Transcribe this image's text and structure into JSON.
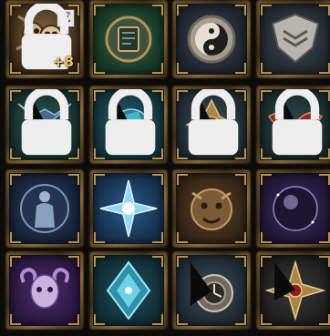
{
  "grid": {
    "slots": [
      {
        "id": "skull-relic",
        "icon": "skull-relic-icon",
        "badge": "E",
        "level": "+8",
        "locked": true
      },
      {
        "id": "tome",
        "icon": "tome-orb-icon",
        "locked": false
      },
      {
        "id": "yin-yang",
        "icon": "yin-yang-icon",
        "locked": false
      },
      {
        "id": "shield-crest",
        "icon": "winged-shield-icon",
        "locked": false
      },
      {
        "id": "horned-mask-blue",
        "icon": "horned-mask-icon",
        "locked": true
      },
      {
        "id": "crystal-dragon",
        "icon": "crystal-dragon-icon",
        "locked": true
      },
      {
        "id": "golden-rune",
        "icon": "golden-rune-icon",
        "locked": true
      },
      {
        "id": "crimson-wing",
        "icon": "crimson-wing-icon",
        "locked": true
      },
      {
        "id": "statue-seal",
        "icon": "statue-seal-icon",
        "locked": false
      },
      {
        "id": "ice-star",
        "icon": "ice-star-icon",
        "locked": false
      },
      {
        "id": "beast-head",
        "icon": "beast-head-icon",
        "locked": false
      },
      {
        "id": "dark-orb",
        "icon": "dark-orb-icon",
        "locked": false
      },
      {
        "id": "ram-skull",
        "icon": "ram-skull-icon",
        "locked": false
      },
      {
        "id": "frost-gate",
        "icon": "frost-gate-icon",
        "locked": false
      },
      {
        "id": "clockwork",
        "icon": "clockwork-icon",
        "locked": false
      },
      {
        "id": "gold-compass",
        "icon": "gold-compass-icon",
        "locked": false
      }
    ]
  }
}
